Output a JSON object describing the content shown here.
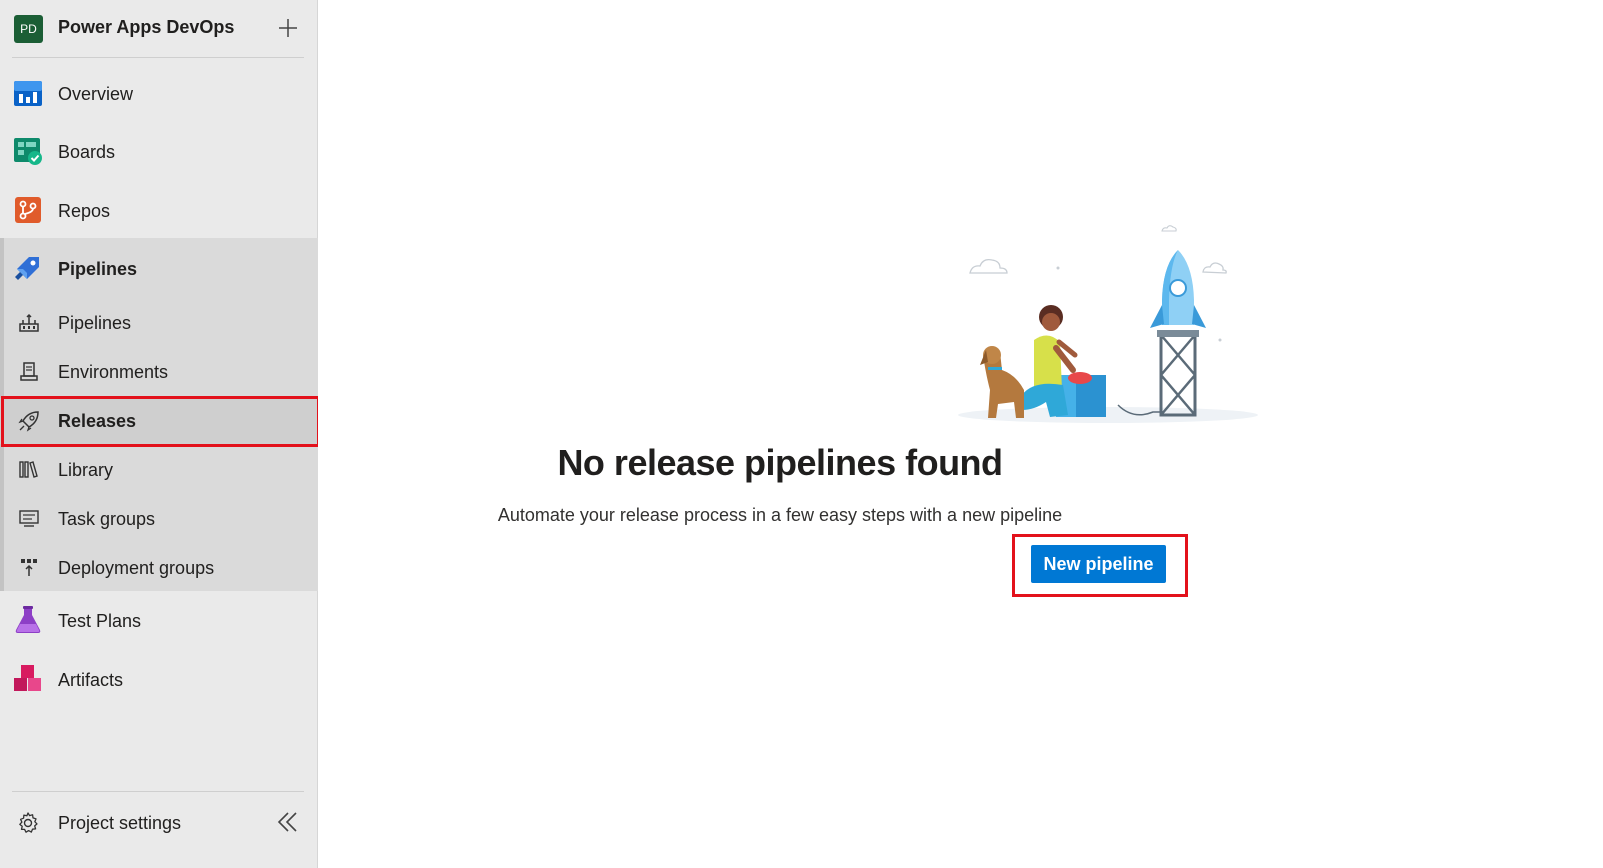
{
  "project": {
    "initials": "PD",
    "name": "Power Apps DevOps"
  },
  "nav": {
    "overview": "Overview",
    "boards": "Boards",
    "repos": "Repos",
    "pipelines": "Pipelines",
    "test_plans": "Test Plans",
    "artifacts": "Artifacts"
  },
  "pipelines_sub": {
    "pipelines": "Pipelines",
    "environments": "Environments",
    "releases": "Releases",
    "library": "Library",
    "task_groups": "Task groups",
    "deployment_groups": "Deployment groups"
  },
  "footer": {
    "project_settings": "Project settings"
  },
  "empty_state": {
    "title": "No release pipelines found",
    "description": "Automate your release process in a few easy steps with a new pipeline",
    "button": "New pipeline"
  },
  "colors": {
    "accent": "#0078d4",
    "highlight": "#e3111b",
    "sidebar": "#eaeaea"
  }
}
